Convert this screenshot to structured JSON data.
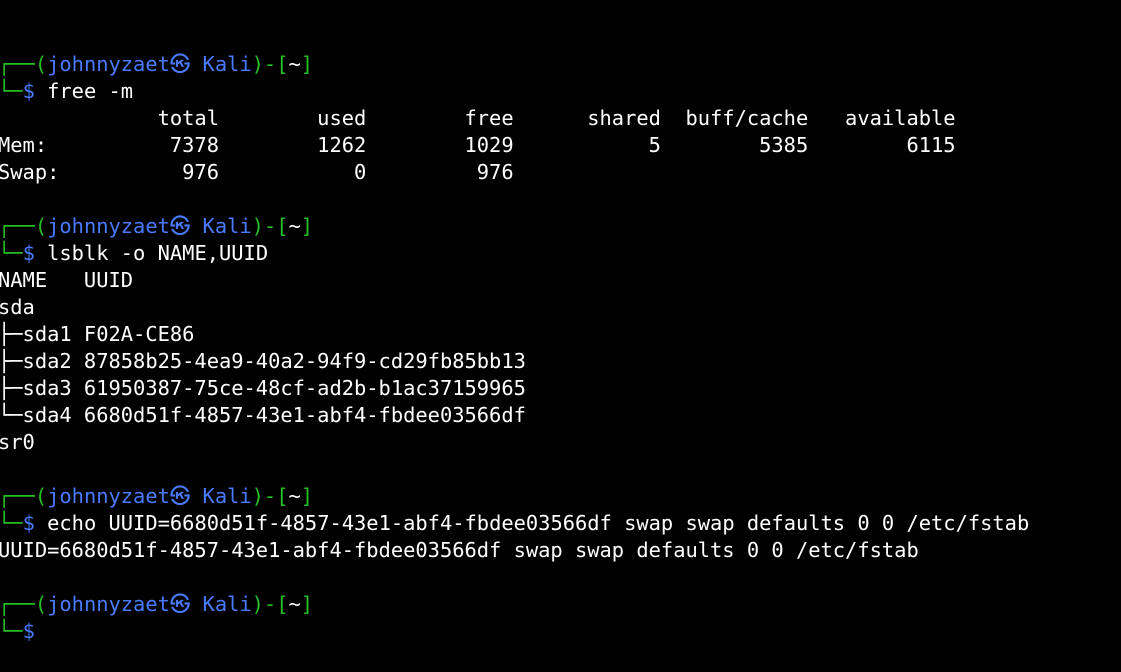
{
  "theme": {
    "background": "#000000",
    "prompt_green": "#26c026",
    "prompt_blue": "#4a7bff",
    "text": "#ffffff"
  },
  "prompt": {
    "corner_top": "┌──(",
    "user_host": "johnnyzaet㉿ Kali",
    "path_open": ")-[",
    "path": "~",
    "path_close": "]",
    "corner_bottom": "└─",
    "dollar": "$"
  },
  "blocks": [
    {
      "command": "free -m",
      "output": [
        "             total        used        free      shared  buff/cache   available",
        "Mem:          7378        1262        1029           5        5385        6115",
        "Swap:          976           0         976"
      ]
    },
    {
      "command": "lsblk -o NAME,UUID",
      "output": [
        "NAME   UUID",
        "sda",
        "├─sda1 F02A-CE86",
        "├─sda2 87858b25-4ea9-40a2-94f9-cd29fb85bb13",
        "├─sda3 61950387-75ce-48cf-ad2b-b1ac37159965",
        "└─sda4 6680d51f-4857-43e1-abf4-fbdee03566df",
        "sr0"
      ]
    },
    {
      "command": "echo UUID=6680d51f-4857-43e1-abf4-fbdee03566df swap swap defaults 0 0 /etc/fstab",
      "output": [
        "UUID=6680d51f-4857-43e1-abf4-fbdee03566df swap swap defaults 0 0 /etc/fstab"
      ]
    }
  ]
}
